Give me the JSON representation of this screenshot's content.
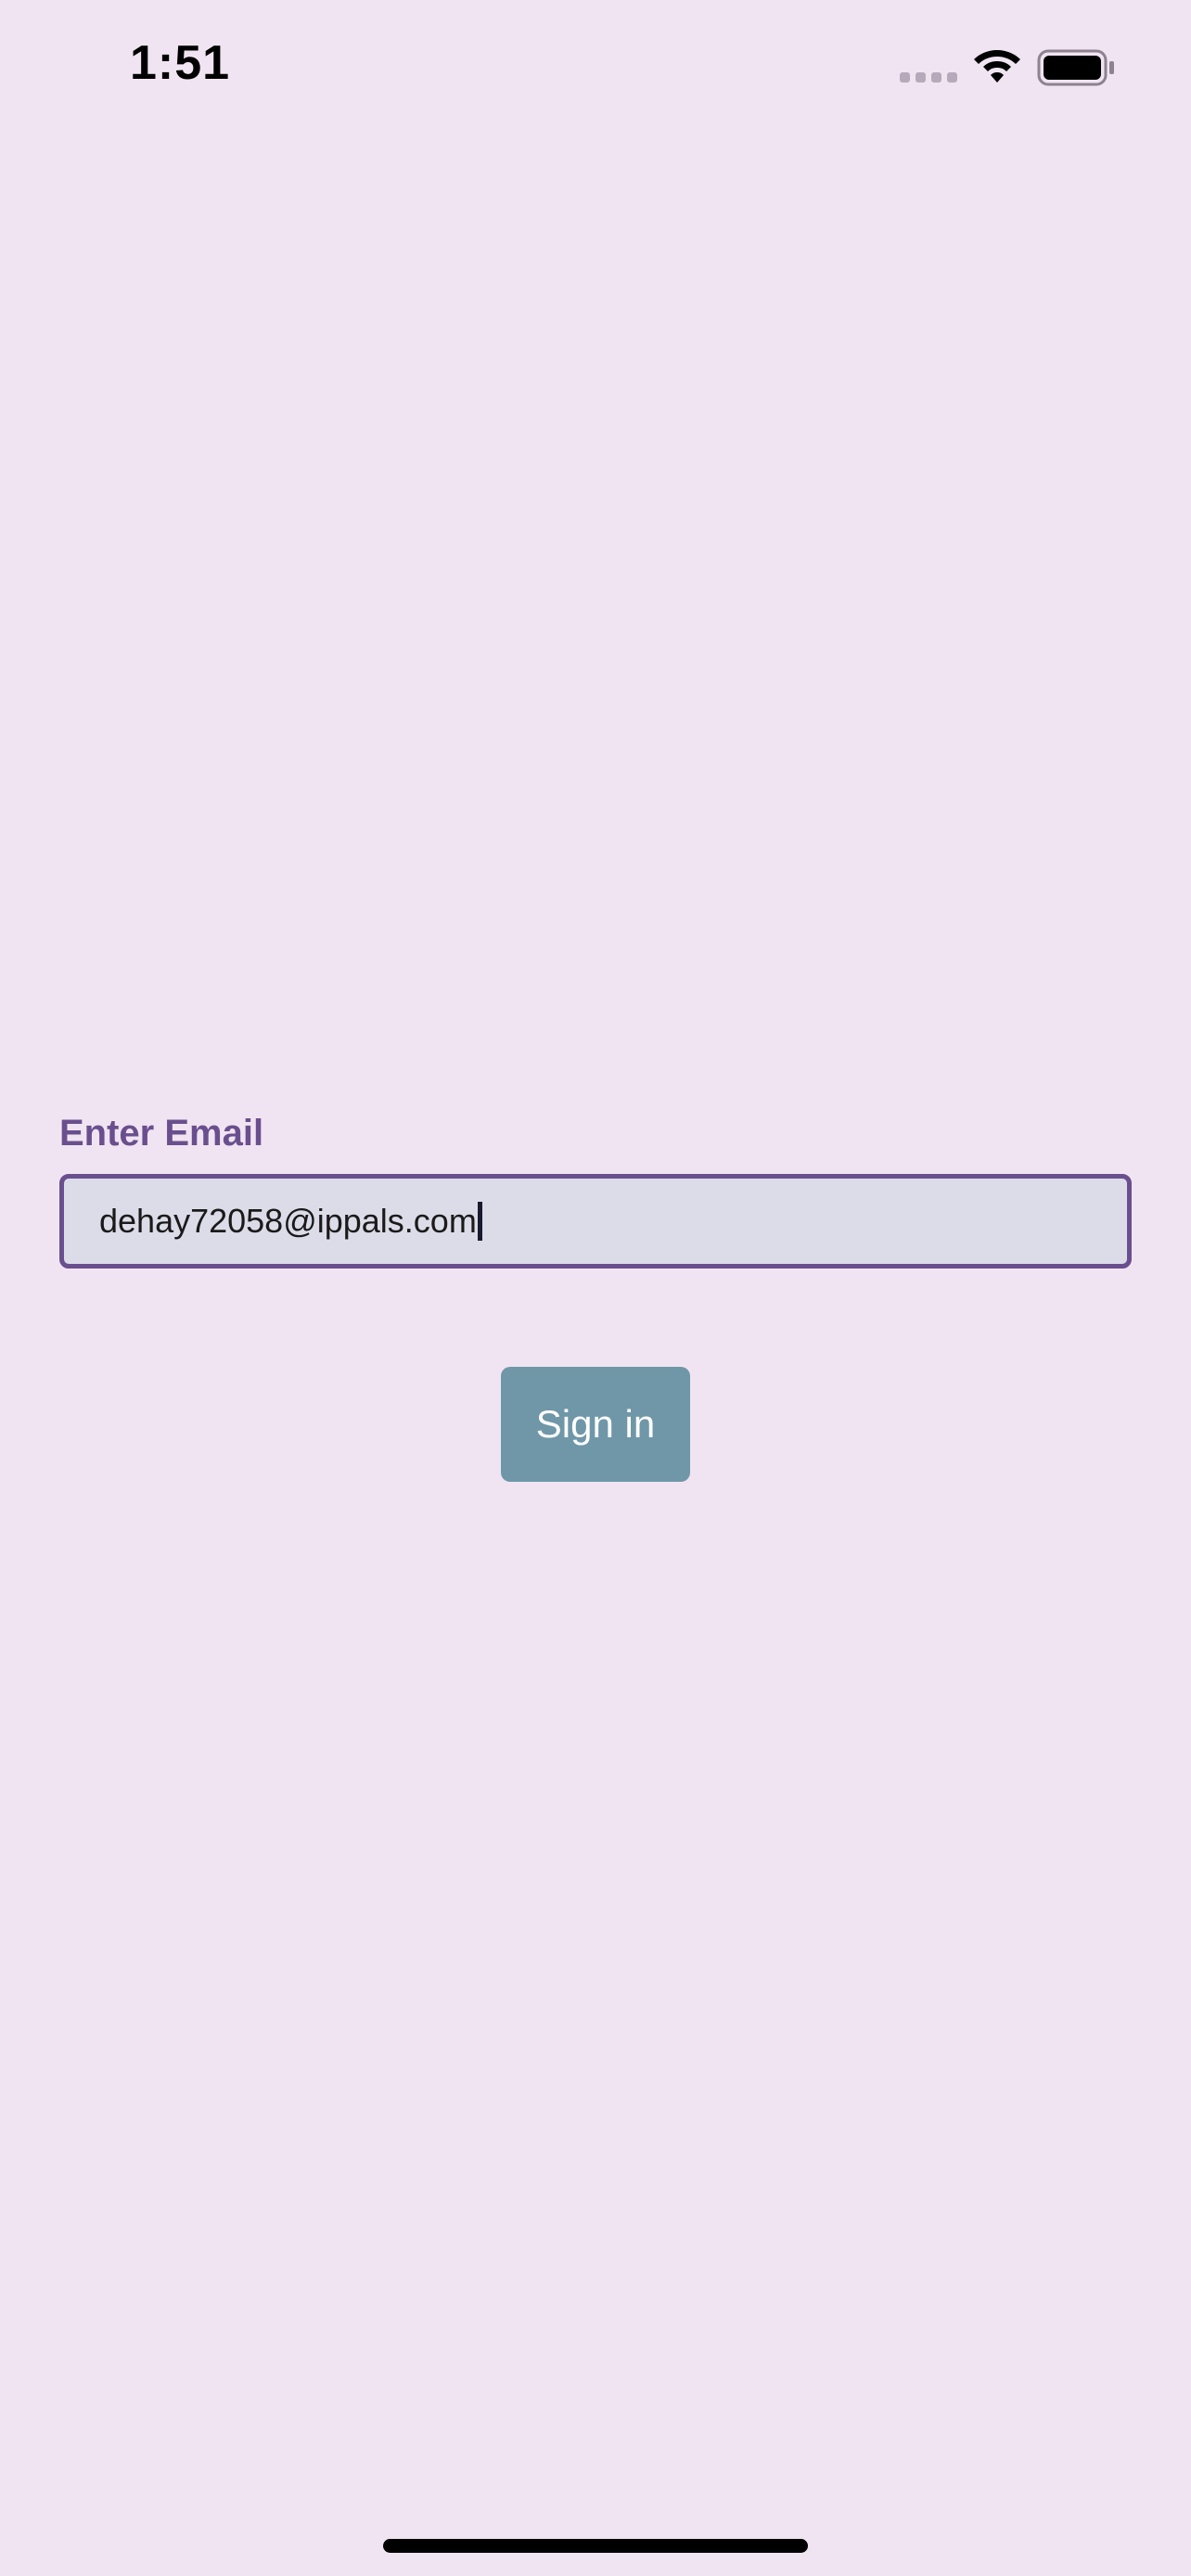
{
  "status_bar": {
    "time": "1:51",
    "signal_icon": "cellular-signal-icon",
    "wifi_icon": "wifi-icon",
    "battery_icon": "battery-icon"
  },
  "form": {
    "label": "Enter Email",
    "email_value": "dehay72058@ippals.com"
  },
  "signin_button": {
    "label": "Sign in"
  },
  "colors": {
    "background": "#f1e4f2",
    "accent": "#6a4f8e",
    "input_background": "#dcdce9",
    "button": "#6f97a8"
  }
}
